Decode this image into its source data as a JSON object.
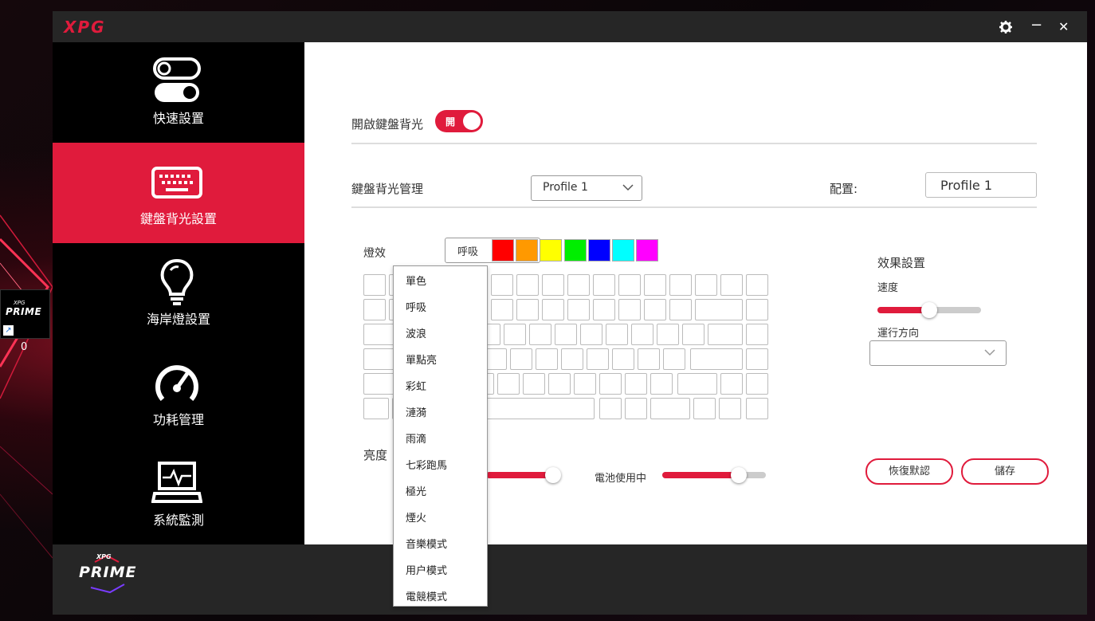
{
  "desktop": {
    "shortcut_logo_small": "XPG",
    "shortcut_logo": "PRIME",
    "shortcut_label": "0"
  },
  "window": {
    "brand": "XPG",
    "settings_icon": "gear-icon",
    "minimize_glyph": "−",
    "close_glyph": "✕"
  },
  "sidebar": {
    "items": [
      {
        "label": "快速設置",
        "icon": "toggle-switches-icon"
      },
      {
        "label": "鍵盤背光設置",
        "icon": "keyboard-icon"
      },
      {
        "label": "海岸燈設置",
        "icon": "lightbulb-icon"
      },
      {
        "label": "功耗管理",
        "icon": "speedometer-icon"
      },
      {
        "label": "系統監測",
        "icon": "laptop-monitor-icon"
      }
    ],
    "active_index": 1
  },
  "main": {
    "backlight_label": "開啟鍵盤背光",
    "backlight_toggle": "開",
    "manage_label": "鍵盤背光管理",
    "profile_select": "Profile 1",
    "config_label": "配置:",
    "config_value": "Profile 1",
    "effect_label": "燈效",
    "effect_select": "呼吸",
    "colors": [
      "#ff0000",
      "#ff9900",
      "#ffff00",
      "#00ee00",
      "#0000ff",
      "#00ffff",
      "#ff00ff"
    ],
    "brightness_label": "亮度",
    "battery_label": "電池使用中",
    "battery_brightness": 0.74,
    "ac_brightness": 0.96,
    "effect_settings_label": "效果設置",
    "speed_label": "速度",
    "speed_value": 0.5,
    "direction_label": "運行方向",
    "direction_value": "",
    "restore_button": "恢復默認",
    "save_button": "儲存"
  },
  "effect_dropdown": {
    "options": [
      "單色",
      "呼吸",
      "波浪",
      "單點亮",
      "彩虹",
      "漣漪",
      "雨滴",
      "七彩跑馬",
      "極光",
      "煙火",
      "音樂模式",
      "用户模式",
      "電競模式"
    ]
  },
  "footer": {
    "logo_small": "XPG",
    "logo": "PRIME"
  },
  "accent_color": "#e01b3c"
}
